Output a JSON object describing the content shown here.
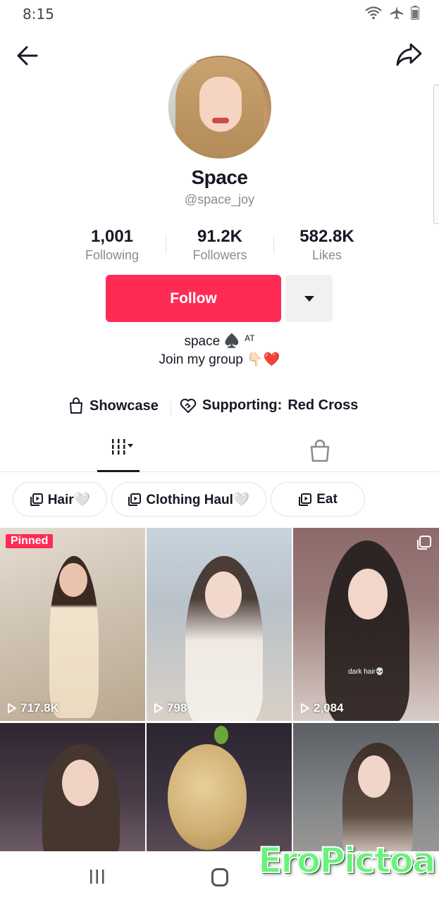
{
  "status_bar": {
    "time": "8:15"
  },
  "profile": {
    "display_name": "Space",
    "username": "@space_joy",
    "stats": [
      {
        "value": "1,001",
        "label": "Following"
      },
      {
        "value": "91.2K",
        "label": "Followers"
      },
      {
        "value": "582.8K",
        "label": "Likes"
      }
    ],
    "follow_label": "Follow",
    "bio_line1": "space ♠️",
    "bio_at": "AT",
    "bio_line2": "Join my group 👇🏻❤️"
  },
  "links": {
    "showcase": "Showcase",
    "supporting": "Supporting:",
    "supporting_org": "Red Cross"
  },
  "playlists": [
    {
      "label": "Hair🤍"
    },
    {
      "label": "Clothing Haul🤍"
    },
    {
      "label": "Eat"
    }
  ],
  "videos": [
    {
      "views": "717.8K",
      "pinned": "Pinned"
    },
    {
      "views": "798"
    },
    {
      "views": "2,084",
      "caption": "dark hair💀"
    },
    {
      "views": ""
    },
    {
      "views": ""
    },
    {
      "views": ""
    }
  ],
  "watermark": "EroPictoa",
  "colors": {
    "accent": "#fe2c55",
    "text": "#161823",
    "muted": "#8a8b91"
  }
}
